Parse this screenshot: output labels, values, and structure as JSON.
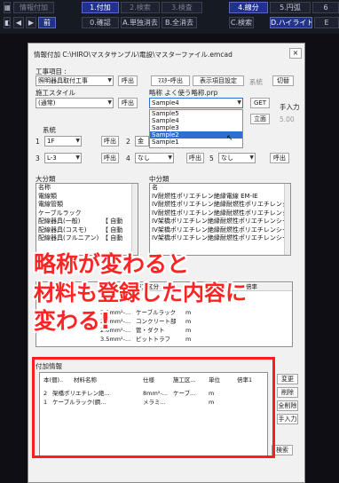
{
  "topbar": {
    "row1": [
      {
        "label": "情報付加",
        "style": "dim"
      },
      {
        "label": "1.付加",
        "style": "blue"
      },
      {
        "label": "2.検索",
        "style": "dim"
      },
      {
        "label": "3.検査",
        "style": "dim"
      },
      {
        "label": "4.線分",
        "style": "blue"
      },
      {
        "label": "5.円弧",
        "style": ""
      },
      {
        "label": "6",
        "style": ""
      }
    ],
    "row2": [
      {
        "label": "前",
        "style": "blue"
      },
      {
        "label": "0.確認",
        "style": ""
      },
      {
        "label": "A.単独消去",
        "style": ""
      },
      {
        "label": "B.全消去",
        "style": ""
      },
      {
        "label": "C.検索",
        "style": ""
      },
      {
        "label": "D.ハイライト",
        "style": "blue"
      },
      {
        "label": "E",
        "style": ""
      }
    ]
  },
  "dialog": {
    "title": "情報付加 C:\\HIRO\\マスタサンプル\\電設\\マスターファイル.emcad",
    "koji_label": "工事項目 :",
    "koji_value": "照明器具取付工事",
    "buttons_row1": [
      "呼出",
      "ﾏｽﾀｰ呼出",
      "表示項目設定",
      "系統",
      "切替"
    ],
    "seko_label": "施工スタイル",
    "seko_value": "(通常)",
    "seko_call": "呼出",
    "ryaku_label": "略称 よく使う略称.prp",
    "ryaku_value": "Sample4",
    "get_button": "GET",
    "tenyuryoku_label": "手入力",
    "ritsumen_button": "立面",
    "ritsumen_value": "5.00",
    "dropdown_options": [
      "Sample5",
      "Sample4",
      "Sample3",
      "Sample2",
      "Sample1"
    ],
    "dropdown_selected_index": 3,
    "keito_label": "系統",
    "keito_rows": [
      {
        "n": "1",
        "v": "1F",
        "btn": "呼出",
        "n2": "2",
        "v2": "金"
      },
      {
        "n": "3",
        "v": "L-3",
        "btn": "呼出",
        "n2": "4",
        "v2": "なし",
        "btn2": "呼出",
        "n3": "5",
        "v3": "なし",
        "btn3": "呼出"
      }
    ],
    "daibunrui_label": "大分類",
    "daibunrui_items": [
      "名称",
      "電線類",
      "電線管類",
      "ケーブルラック",
      "配線器具(一般)",
      "配線器具(コスモ)",
      "配線器具(フルニアン)"
    ],
    "daibunrui_extra": [
      "",
      "",
      "",
      "",
      "【 自動",
      "【 自動",
      "【 自動"
    ],
    "chubunrui_label": "中分類",
    "chubunrui_items": [
      "名",
      "IV耐燃性ポリエチレン絶縁電線 EM-IE",
      "IV耐燃性ポリエチレン絶縁耐燃性ポリエチレンシースケーブ",
      "IV耐燃性ポリエチレン絶縁耐燃性ポリエチレンシースケーブ",
      "IV架橋ポリエチレン絶縁耐燃性ポリエチレンシースケーブ",
      "IV架橋ポリエチレン絶縁耐燃性ポリエチレンシースケーブ",
      "IV架橋ポリエチレン絶縁耐燃性ポリエチレンシースケーブ"
    ],
    "material_headers": [
      "材料名称",
      "仕様",
      "施工区分",
      "単位",
      "倍率"
    ],
    "material_rows": [
      {
        "name": "",
        "spec": "2.0mm²-...",
        "kubun": "ケーブルラック",
        "unit": "m"
      },
      {
        "name": "",
        "spec": "2.0mm²-...",
        "kubun": "コンクリート部",
        "unit": "m"
      },
      {
        "name": "",
        "spec": "2.0mm²-...",
        "kubun": "管・ダクト",
        "unit": "m"
      },
      {
        "name": "",
        "spec": "3.5mm²-...",
        "kubun": "ピットトラフ",
        "unit": "m"
      }
    ],
    "fuka_label": "付加情報",
    "fuka_headers": [
      "本(個)..",
      "材料名称",
      "仕様",
      "施工区...",
      "単位",
      "倍率1"
    ],
    "fuka_rows": [
      {
        "qty": "2",
        "name": "架橋ポリエチレン絶...",
        "spec": "8mm²-...",
        "kubun": "ケーブ...",
        "unit": "m"
      },
      {
        "qty": "1",
        "name": "ケーブルラック(鋼...",
        "spec": "メラミ...",
        "kubun": "",
        "unit": "m"
      }
    ],
    "side_buttons": [
      "変更",
      "削除",
      "全削除",
      "手入力"
    ],
    "kensaku_button": "検索"
  },
  "caption": {
    "line1": "略称が変わると",
    "line2": "材料も登録した内容に",
    "line3": "変わる!"
  }
}
